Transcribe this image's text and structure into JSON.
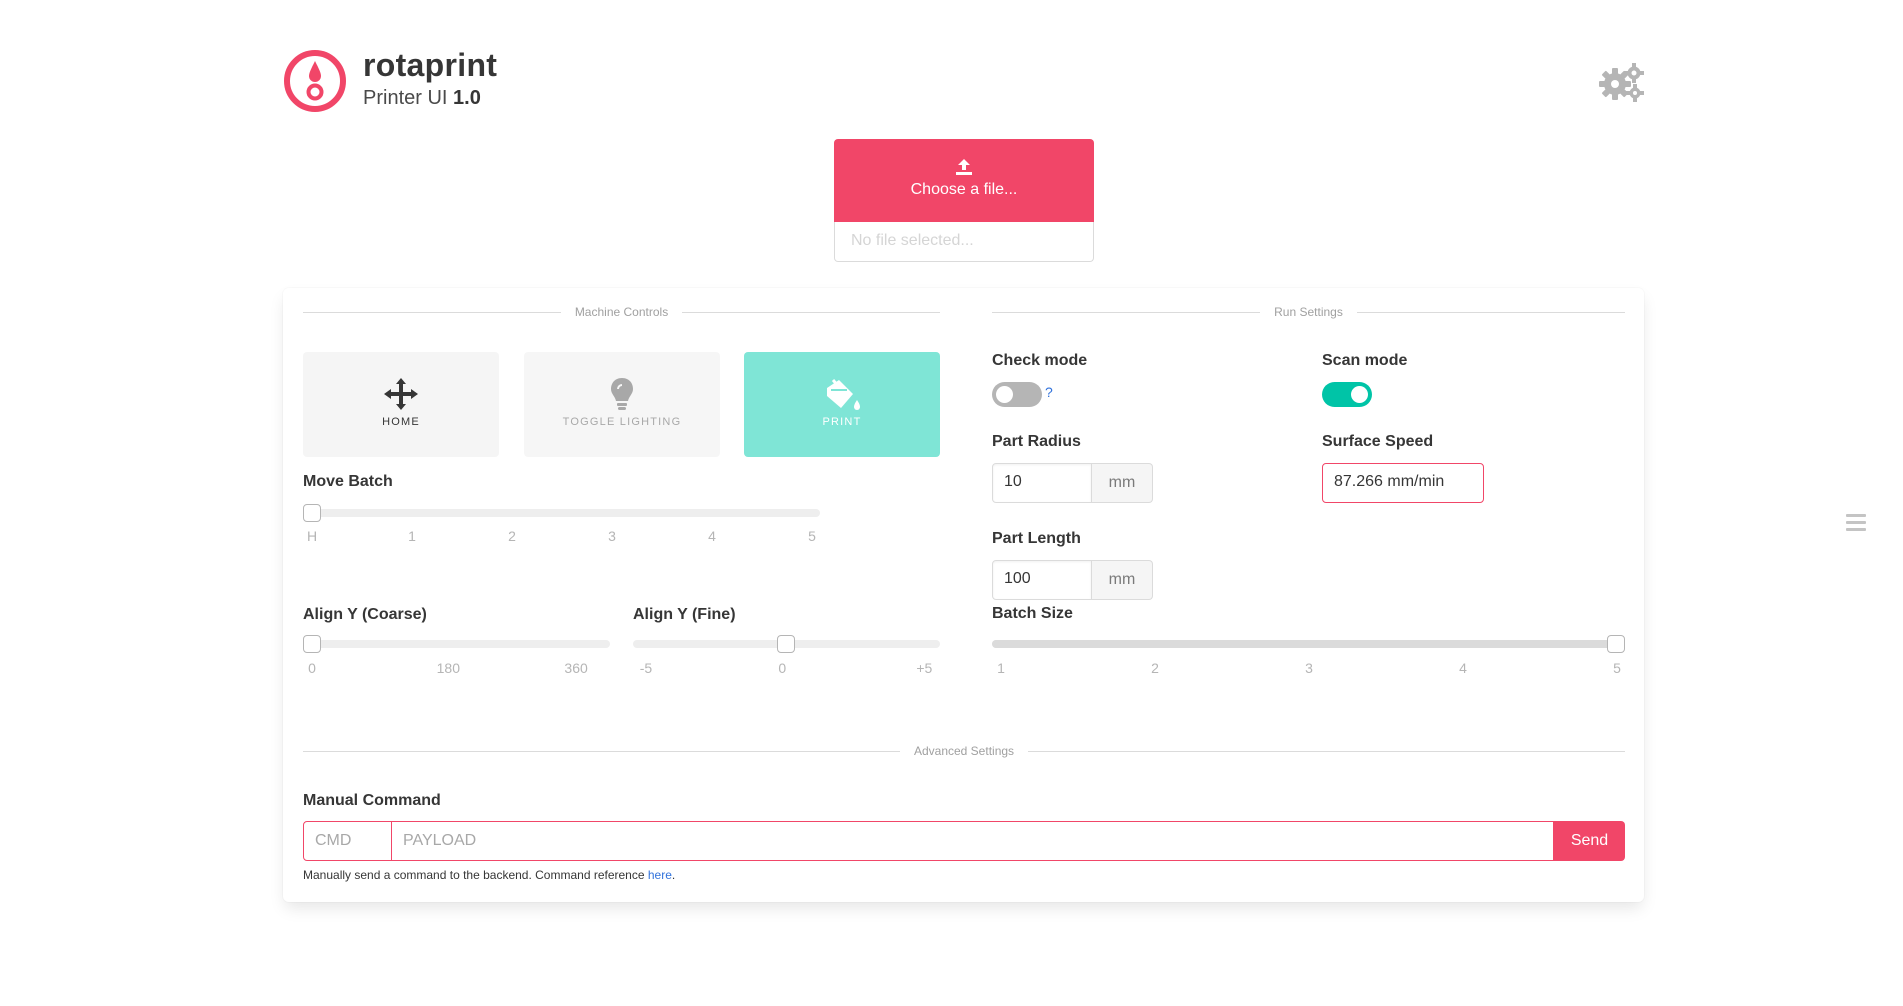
{
  "header": {
    "brand": "rotaprint",
    "subtitle": "Printer UI",
    "version": "1.0",
    "icons": {
      "logo": "droplet-target-icon",
      "settings": "gears-icon"
    }
  },
  "upload": {
    "button_label": "Choose a file...",
    "file_name": "No file selected...",
    "icon": "upload-icon"
  },
  "machine_controls": {
    "section_title": "Machine Controls",
    "buttons": [
      {
        "label": "HOME",
        "icon": "arrows-move-icon"
      },
      {
        "label": "TOGGLE LIGHTING",
        "icon": "lightbulb-icon"
      },
      {
        "label": "PRINT",
        "icon": "paint-bucket-icon"
      }
    ],
    "move_batch": {
      "label": "Move Batch",
      "ticks": [
        "H",
        "1",
        "2",
        "3",
        "4",
        "5"
      ],
      "value": "H"
    },
    "align_coarse": {
      "label": "Align Y (Coarse)",
      "ticks": [
        "0",
        "180",
        "360"
      ],
      "value": 0
    },
    "align_fine": {
      "label": "Align Y (Fine)",
      "ticks": [
        "-5",
        "0",
        "+5"
      ],
      "value": 0
    }
  },
  "run_settings": {
    "section_title": "Run Settings",
    "check_mode": {
      "label": "Check mode",
      "on": false,
      "help": "?"
    },
    "scan_mode": {
      "label": "Scan mode",
      "on": true
    },
    "part_radius": {
      "label": "Part Radius",
      "value": "10",
      "unit": "mm"
    },
    "surface_speed": {
      "label": "Surface Speed",
      "value": "87.266 mm/min"
    },
    "part_length": {
      "label": "Part Length",
      "value": "100",
      "unit": "mm"
    },
    "batch_size": {
      "label": "Batch Size",
      "ticks": [
        "1",
        "2",
        "3",
        "4",
        "5"
      ],
      "value": 5
    }
  },
  "advanced": {
    "section_title": "Advanced Settings",
    "manual_command": {
      "label": "Manual Command",
      "cmd_placeholder": "CMD",
      "payload_placeholder": "PAYLOAD",
      "send_label": "Send",
      "help_text": "Manually send a command to the backend. Command reference ",
      "help_link": "here",
      "help_end": "."
    }
  },
  "colors": {
    "accent": "#f14668",
    "success": "#00c4a7",
    "print": "#7fe5d6"
  }
}
